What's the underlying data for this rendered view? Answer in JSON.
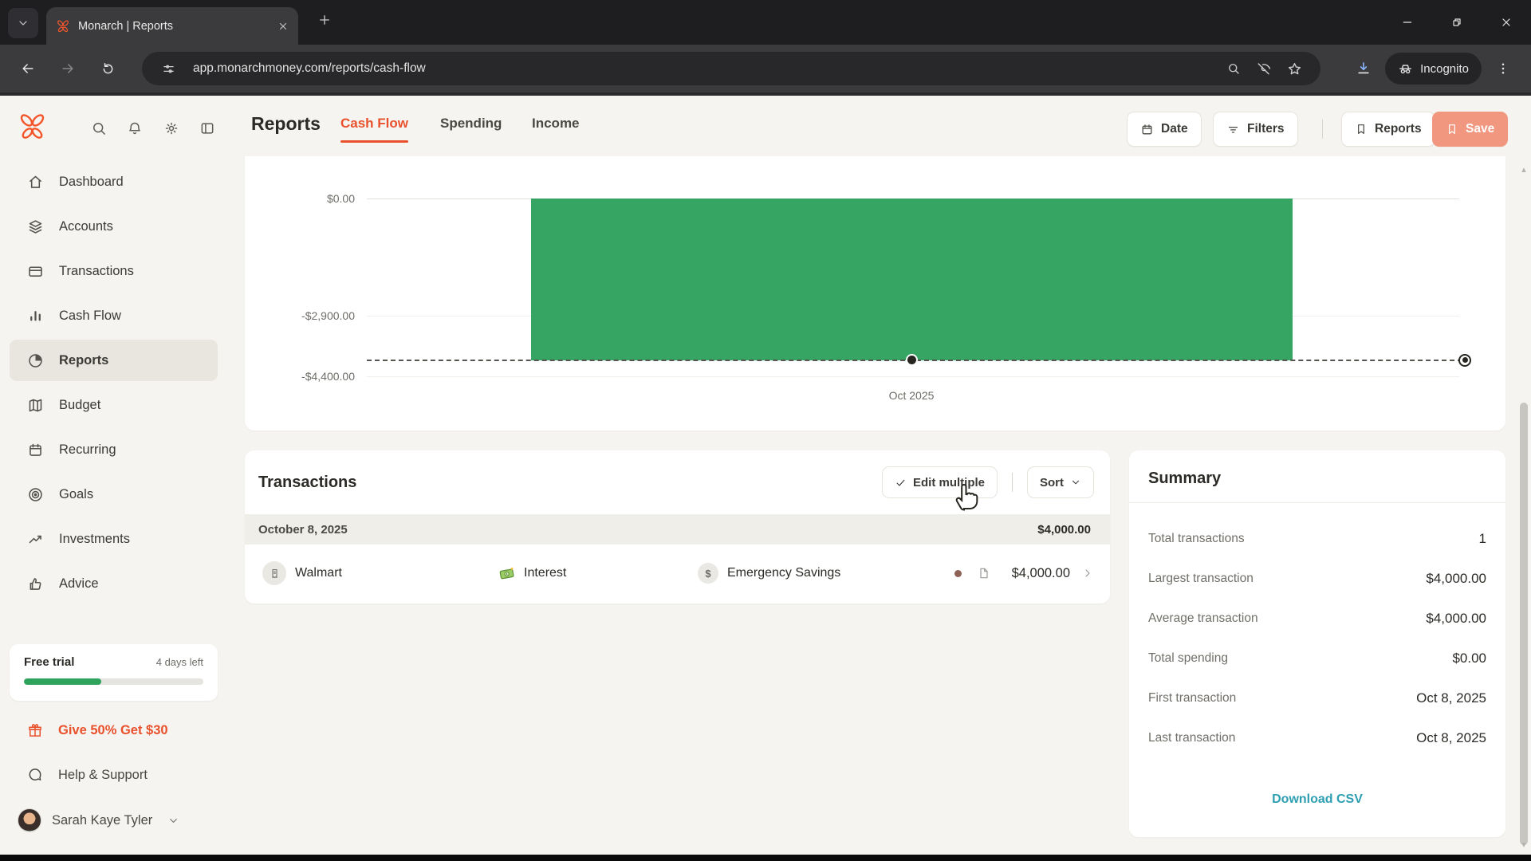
{
  "browser": {
    "tab_title": "Monarch | Reports",
    "url": "app.monarchmoney.com/reports/cash-flow",
    "incognito_label": "Incognito"
  },
  "header": {
    "title": "Reports",
    "tabs": [
      {
        "label": "Cash Flow",
        "active": true
      },
      {
        "label": "Spending",
        "active": false
      },
      {
        "label": "Income",
        "active": false
      }
    ],
    "actions": {
      "date": "Date",
      "filters": "Filters",
      "reports": "Reports",
      "save": "Save"
    }
  },
  "sidebar": {
    "items": [
      {
        "label": "Dashboard"
      },
      {
        "label": "Accounts"
      },
      {
        "label": "Transactions"
      },
      {
        "label": "Cash Flow"
      },
      {
        "label": "Reports"
      },
      {
        "label": "Budget"
      },
      {
        "label": "Recurring"
      },
      {
        "label": "Goals"
      },
      {
        "label": "Investments"
      },
      {
        "label": "Advice"
      }
    ],
    "active_item": "Reports",
    "trial": {
      "title": "Free trial",
      "remaining": "4 days left",
      "progress_percent": 43
    },
    "promo": "Give 50% Get $30",
    "help": "Help & Support",
    "user": "Sarah Kaye Tyler"
  },
  "chart_data": {
    "type": "bar",
    "categories": [
      "Oct 2025"
    ],
    "values": [
      -4000
    ],
    "ytick_labels": [
      "$0.00",
      "-$2,900.00",
      "-$4,400.00"
    ],
    "ytick_values": [
      0,
      -2900,
      -4400
    ],
    "reference_line": -4000,
    "bar_color": "#36A563",
    "grid": true,
    "legend": "none",
    "xlabel": "",
    "ylabel": ""
  },
  "transactions": {
    "title": "Transactions",
    "edit_multiple_label": "Edit multiple",
    "sort_label": "Sort",
    "groups": [
      {
        "date": "October 8, 2025",
        "total": "$4,000.00",
        "rows": [
          {
            "merchant": "Walmart",
            "category": "Interest",
            "account": "Emergency Savings",
            "amount": "$4,000.00"
          }
        ]
      }
    ]
  },
  "summary": {
    "title": "Summary",
    "rows": [
      {
        "label": "Total transactions",
        "value": "1"
      },
      {
        "label": "Largest transaction",
        "value": "$4,000.00"
      },
      {
        "label": "Average transaction",
        "value": "$4,000.00"
      },
      {
        "label": "Total spending",
        "value": "$0.00"
      },
      {
        "label": "First transaction",
        "value": "Oct 8, 2025"
      },
      {
        "label": "Last transaction",
        "value": "Oct 8, 2025"
      }
    ],
    "download_label": "Download CSV"
  },
  "colors": {
    "accent_orange": "#E8512C",
    "save_salmon": "#F2977F",
    "bar_green": "#36A563",
    "progress_green": "#2EA35C",
    "link_teal": "#2E9FB2",
    "page_bg": "#F6F4F0",
    "chrome_dark": "#1E1E20",
    "toolbar_dark": "#3B3B3E"
  }
}
